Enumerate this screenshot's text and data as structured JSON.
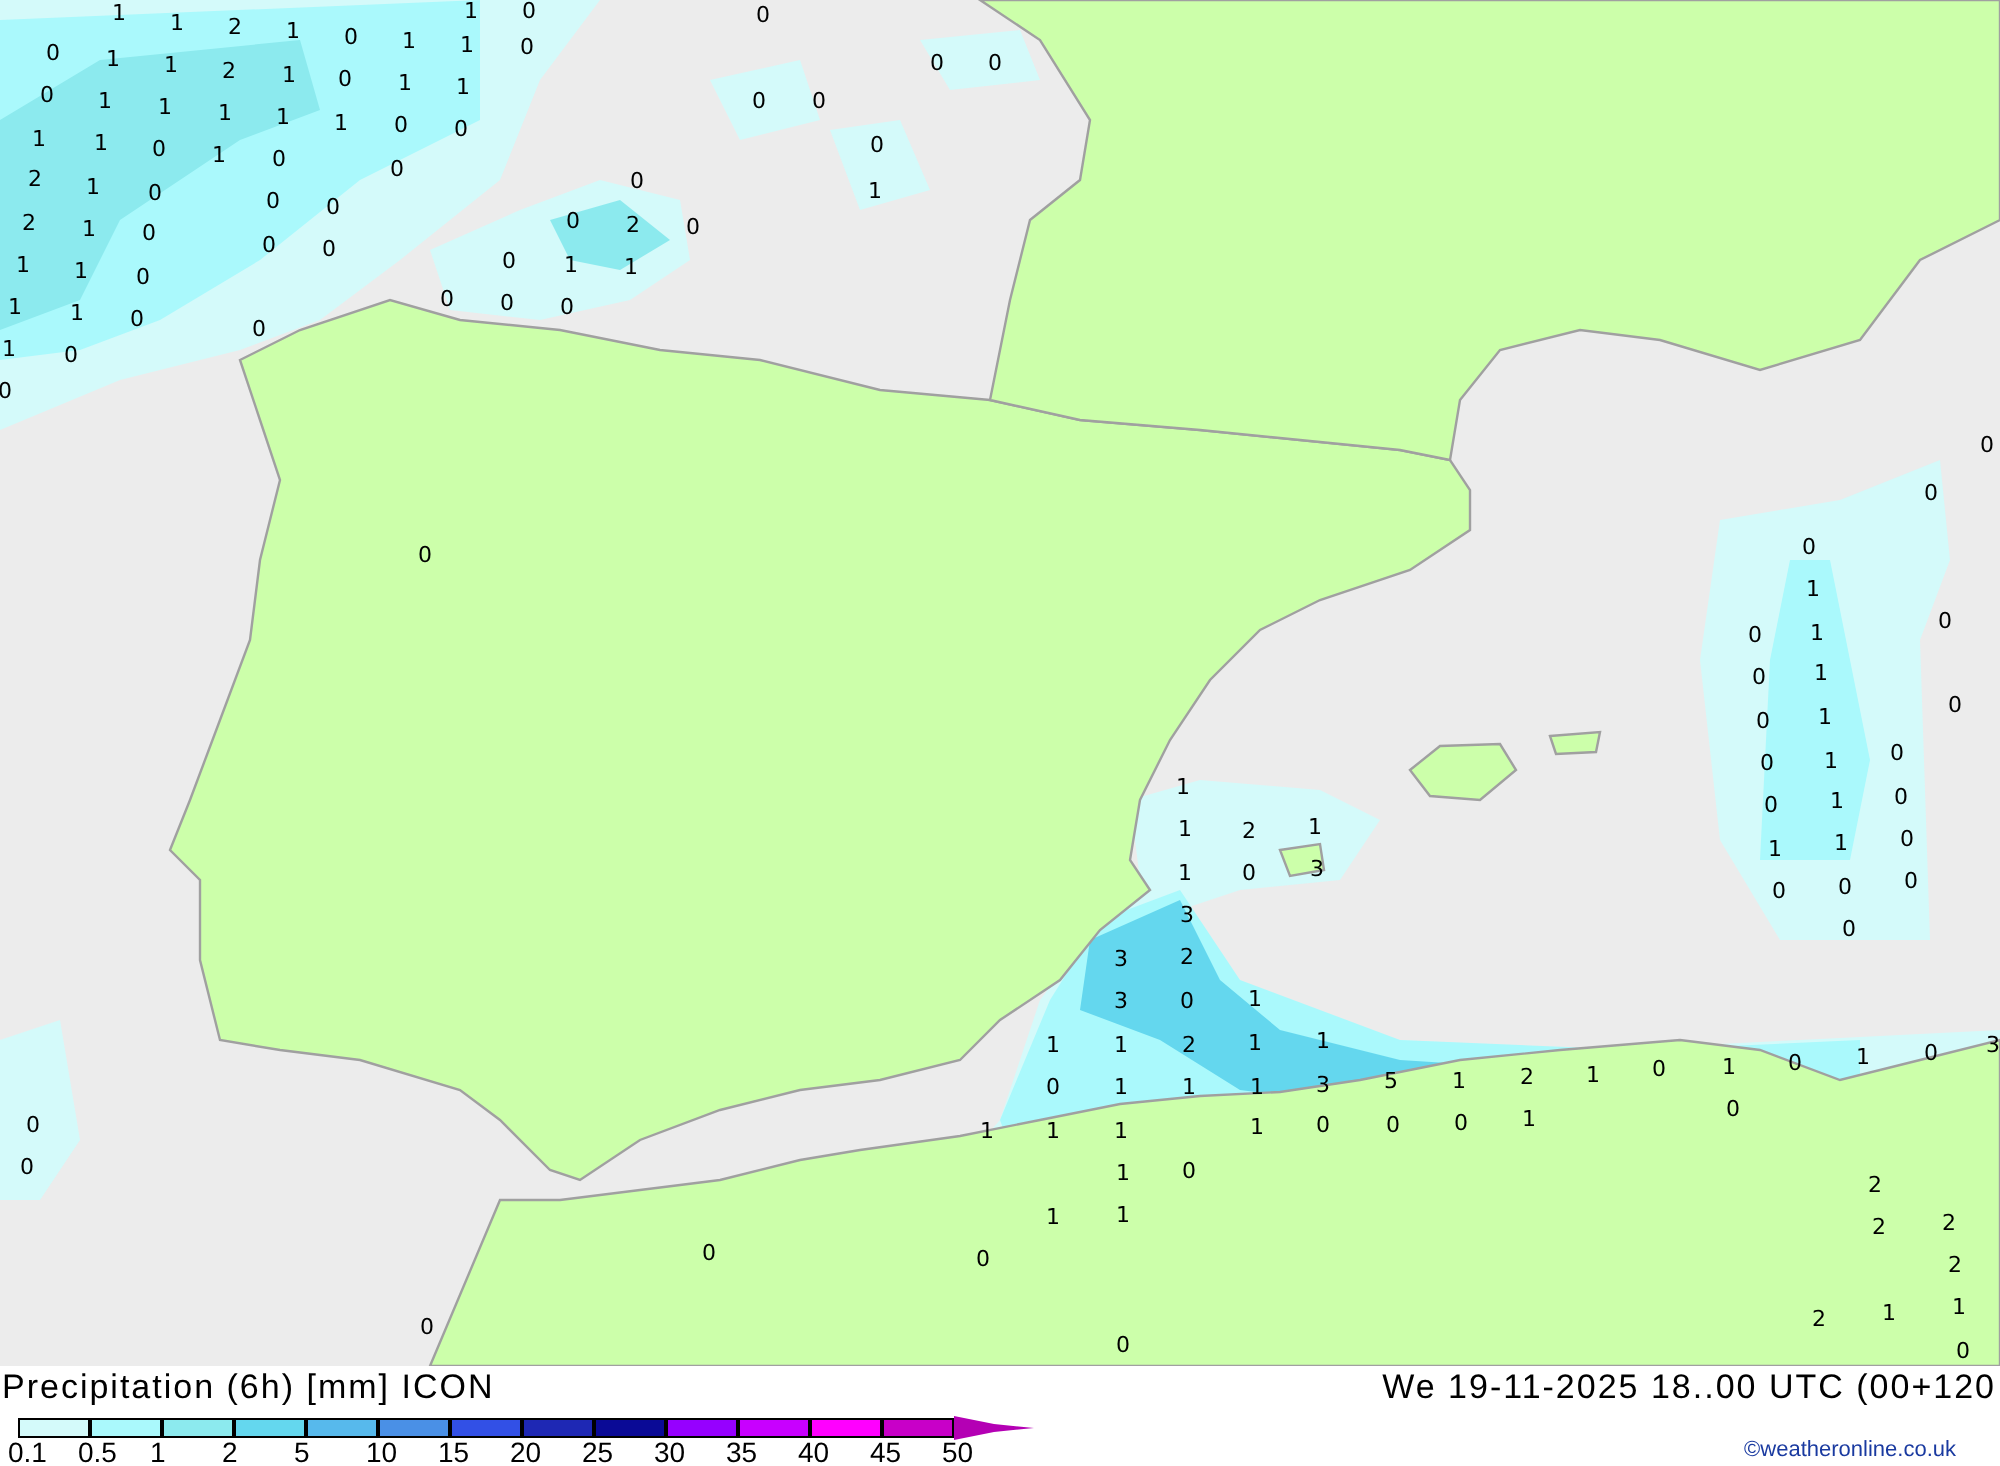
{
  "map": {
    "labels": [
      "1",
      "1",
      "2",
      "1",
      "0",
      "1",
      "1",
      "0",
      "1",
      "0",
      "0",
      "0",
      "1",
      "1",
      "2",
      "1",
      "0",
      "1",
      "1",
      "0",
      "0",
      "0",
      "1",
      "1",
      "1",
      "1",
      "1",
      "0",
      "0",
      "0",
      "0",
      "1",
      "1",
      "0",
      "1",
      "0",
      "0",
      "0",
      "1",
      "2",
      "1",
      "0",
      "0",
      "0",
      "0",
      "2",
      "1",
      "0",
      "0",
      "0",
      "0",
      "2",
      "0",
      "1",
      "1",
      "0",
      "0",
      "1",
      "1",
      "1",
      "1",
      "0",
      "0",
      "0",
      "0",
      "1",
      "0",
      "0",
      "0",
      "0",
      "0",
      "0",
      "0",
      "1",
      "1",
      "1",
      "1",
      "1",
      "1",
      "1",
      "0",
      "0",
      "0",
      "0",
      "0",
      "1",
      "0",
      "0",
      "0",
      "0",
      "0",
      "0",
      "0",
      "0",
      "0",
      "1",
      "1",
      "2",
      "1",
      "1",
      "0",
      "3",
      "3",
      "3",
      "2",
      "3",
      "0",
      "1",
      "1",
      "1",
      "2",
      "1",
      "1",
      "0",
      "1",
      "1",
      "1",
      "3",
      "5",
      "1",
      "2",
      "1",
      "0",
      "1",
      "0",
      "1",
      "0",
      "3",
      "0",
      "1",
      "1",
      "1",
      "1",
      "0",
      "0",
      "0",
      "1",
      "1",
      "0",
      "1",
      "1",
      "0",
      "0",
      "2",
      "2",
      "2",
      "2",
      "2",
      "1",
      "1",
      "0",
      "0",
      "0",
      "0",
      "0"
    ]
  },
  "footer": {
    "title": "Precipitation (6h) [mm] ICON",
    "datetime": "We 19-11-2025 18..00 UTC (00+120",
    "credit": "©weatheronline.co.uk"
  },
  "legend": {
    "segments": [
      {
        "color": "#d4fafa"
      },
      {
        "color": "#aaf9fc"
      },
      {
        "color": "#8ceaee"
      },
      {
        "color": "#64d7ee"
      },
      {
        "color": "#57b9ec"
      },
      {
        "color": "#4a90e6"
      },
      {
        "color": "#3250e6"
      },
      {
        "color": "#1e28b4"
      },
      {
        "color": "#0a0a96"
      },
      {
        "color": "#9600ff"
      },
      {
        "color": "#c800ff"
      },
      {
        "color": "#ff00ff"
      },
      {
        "color": "#c800c8"
      },
      {
        "kind": "arrow",
        "color": "#b400b4"
      }
    ],
    "ticks": [
      "0.1",
      "0.5",
      "1",
      "2",
      "5",
      "10",
      "15",
      "20",
      "25",
      "30",
      "35",
      "40",
      "45",
      "50"
    ]
  }
}
